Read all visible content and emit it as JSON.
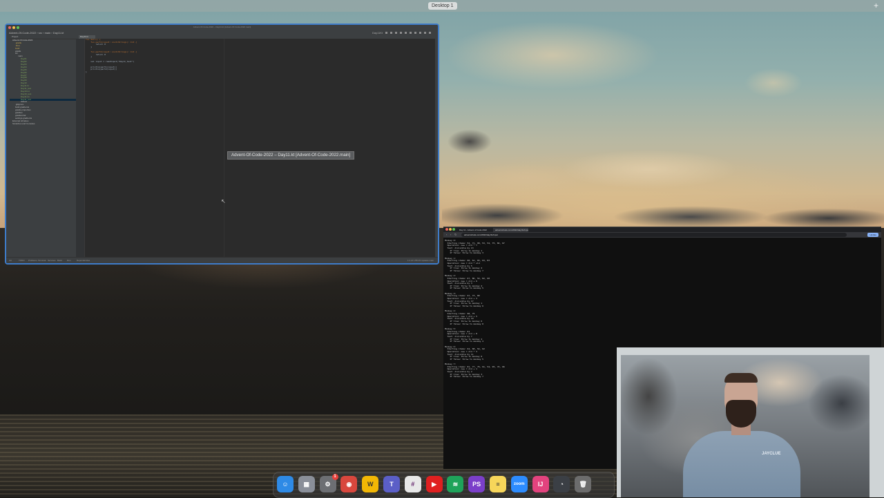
{
  "desktop": {
    "space_label": "Desktop 1",
    "add_space": "+"
  },
  "ide": {
    "title": "Advent-Of-Code-2022 – Day11.kt [Advent-Of-Code-2022.main]",
    "breadcrumb": "Advent-Of-Code-2022 › src › main › Day11.kt",
    "run_config": "Day11Kt",
    "active_tab": "Day11.kt",
    "project_panel_title": "Project",
    "tooltip": "Advent-Of-Code-2022 – Day11.kt [Advent-Of-Code-2022.main]",
    "tree": [
      {
        "label": "Advent-Of-Code-2022",
        "indent": 1,
        "color": "#cfcfcf"
      },
      {
        "label": ".gradle",
        "indent": 2,
        "color": "#c9a94e"
      },
      {
        "label": ".idea",
        "indent": 2,
        "color": "#c9a94e"
      },
      {
        "label": "build",
        "indent": 2,
        "color": "#c9a94e"
      },
      {
        "label": "gradle",
        "indent": 2,
        "color": "#bdbdbd"
      },
      {
        "label": "src",
        "indent": 2,
        "color": "#bdbdbd"
      },
      {
        "label": "main",
        "indent": 3,
        "color": "#bdbdbd"
      },
      {
        "label": "Day01",
        "indent": 4,
        "color": "#7fa35c"
      },
      {
        "label": "Day02",
        "indent": 4,
        "color": "#7fa35c"
      },
      {
        "label": "Day03",
        "indent": 4,
        "color": "#7fa35c"
      },
      {
        "label": "Day04",
        "indent": 4,
        "color": "#7fa35c"
      },
      {
        "label": "Day05",
        "indent": 4,
        "color": "#7fa35c"
      },
      {
        "label": "Day06",
        "indent": 4,
        "color": "#7fa35c"
      },
      {
        "label": "Day07",
        "indent": 4,
        "color": "#7fa35c"
      },
      {
        "label": "Day08",
        "indent": 4,
        "color": "#7fa35c"
      },
      {
        "label": "Day09",
        "indent": 4,
        "color": "#7fa35c"
      },
      {
        "label": "Day10",
        "indent": 4,
        "color": "#7fa35c"
      },
      {
        "label": "Day11.kt",
        "indent": 4,
        "color": "#7fa35c"
      },
      {
        "label": "Day11_test",
        "indent": 4,
        "color": "#7fa35c"
      },
      {
        "label": "Day10.txt",
        "indent": 4,
        "color": "#7fa35c"
      },
      {
        "label": "Day10_test",
        "indent": 4,
        "color": "#7fa35c"
      },
      {
        "label": "Day11.txt",
        "indent": 4,
        "color": "#7fa35c"
      },
      {
        "label": "Day11_test",
        "indent": 4,
        "color": "#7fa35c",
        "selected": true
      },
      {
        "label": "Utils.kt",
        "indent": 4,
        "color": "#bdbdbd"
      },
      {
        "label": ".gitignore",
        "indent": 2,
        "color": "#bdbdbd"
      },
      {
        "label": "build.gradle.kts",
        "indent": 2,
        "color": "#bdbdbd"
      },
      {
        "label": "gradle.properties",
        "indent": 2,
        "color": "#bdbdbd"
      },
      {
        "label": "gradlew",
        "indent": 2,
        "color": "#bdbdbd"
      },
      {
        "label": "gradlew.bat",
        "indent": 2,
        "color": "#bdbdbd"
      },
      {
        "label": "settings.gradle.kts",
        "indent": 2,
        "color": "#bdbdbd"
      },
      {
        "label": "External Libraries",
        "indent": 1,
        "color": "#bdbdbd"
      },
      {
        "label": "Scratches and Consoles",
        "indent": 1,
        "color": "#bdbdbd"
      }
    ],
    "code": [
      {
        "text": "fun main() {",
        "color": "#cc7832"
      },
      {
        "text": "    fun part1(input: List<String>): Int {",
        "color": "#cc7832"
      },
      {
        "text": "        return 0",
        "color": "#a9b7c6"
      },
      {
        "text": "    }",
        "color": "#a9b7c6"
      },
      {
        "text": "",
        "color": "#a9b7c6"
      },
      {
        "text": "    fun part2(input: List<String>): Int {",
        "color": "#cc7832"
      },
      {
        "text": "        return 0",
        "color": "#a9b7c6"
      },
      {
        "text": "    }",
        "color": "#a9b7c6"
      },
      {
        "text": "",
        "color": "#a9b7c6"
      },
      {
        "text": "    val input = readInput(\"Day11_test\")",
        "color": "#a9b7c6"
      },
      {
        "text": "",
        "color": "#a9b7c6"
      },
      {
        "text": "    println(part1(input))",
        "color": "#a9b7c6"
      },
      {
        "text": "    println(part2(input))",
        "color": "#a9b7c6"
      },
      {
        "text": "}",
        "color": "#a9b7c6"
      }
    ],
    "status_left": [
      "Git",
      "TODO",
      "Problems",
      "Terminal",
      "Services",
      "Build",
      "Run",
      "Dependencies"
    ],
    "status_right": "1:1  LF  UTF-8  4 spaces  main"
  },
  "browser": {
    "tabs": [
      "Day 11 - Advent of Code 2022",
      "adventofcode.com/2022/day/11/input"
    ],
    "url": "adventofcode.com/2022/day/11/input",
    "button": "Update",
    "lines": [
      "Monkey 0:",
      "  Starting items: 54, 71, 98, 53, 54, 75, 84, 67",
      "  Operation: new = old * 7",
      "  Test: divisible by 13",
      "    If true: throw to monkey 1",
      "    If false: throw to monkey 3",
      "",
      "Monkey 1:",
      "  Starting items: 60, 61, 65, 63, 83",
      "  Operation: new = old * old",
      "  Test: divisible by 5",
      "    If true: throw to monkey 2",
      "    If false: throw to monkey 7",
      "",
      "Monkey 2:",
      "  Starting items: 67, 86, 54, 82, 60",
      "  Operation: new = old + 6",
      "  Test: divisible by 3",
      "    If true: throw to monkey 4",
      "    If false: throw to monkey 5",
      "",
      "Monkey 3:",
      "  Starting items: 97, 73, 80",
      "  Operation: new = old + 3",
      "  Test: divisible by 17",
      "    If true: throw to monkey 1",
      "    If false: throw to monkey 6",
      "",
      "Monkey 4:",
      "  Starting items: 98, 75",
      "  Operation: new = old + 5",
      "  Test: divisible by 19",
      "    If true: throw to monkey 6",
      "    If false: throw to monkey 0",
      "",
      "Monkey 5:",
      "  Starting items: 61",
      "  Operation: new = old + 8",
      "  Test: divisible by 7",
      "    If true: throw to monkey 2",
      "    If false: throw to monkey 4",
      "",
      "Monkey 6:",
      "  Starting items: 64, 68, 54, 62",
      "  Operation: new = old * 3",
      "  Test: divisible by 11",
      "    If true: throw to monkey 0",
      "    If false: throw to monkey 5",
      "",
      "Monkey 7:",
      "  Starting items: 81, 77, 76, 91, 54, 95, 74, 66",
      "  Operation: new = old + 1",
      "  Test: divisible by 2",
      "    If true: throw to monkey 3",
      "    If false: throw to monkey 7"
    ]
  },
  "webcam": {
    "shirt_logo": "JAYCLUE"
  },
  "dock": [
    {
      "name": "finder",
      "letter": "☺",
      "color": "#2e8ae6"
    },
    {
      "name": "launchpad",
      "letter": "▦",
      "color": "#8a8f99"
    },
    {
      "name": "system-preferences",
      "letter": "⚙",
      "color": "#6d6f73",
      "badge": "1"
    },
    {
      "name": "chrome",
      "letter": "◉",
      "color": "#d9473d"
    },
    {
      "name": "notes-w",
      "letter": "W",
      "color": "#f2b705"
    },
    {
      "name": "teams",
      "letter": "T",
      "color": "#5b5fc7"
    },
    {
      "name": "slack",
      "letter": "#",
      "color": "#e8e8e8"
    },
    {
      "name": "video-player",
      "letter": "▶",
      "color": "#e02020"
    },
    {
      "name": "audio-app",
      "letter": "≋",
      "color": "#1fa35a"
    },
    {
      "name": "phpstorm",
      "letter": "PS",
      "color": "#7b3fc9"
    },
    {
      "name": "notes",
      "letter": "≡",
      "color": "#f7d65a"
    },
    {
      "name": "zoom",
      "letter": "zoom",
      "color": "#2d8cff"
    },
    {
      "name": "intellij",
      "letter": "IJ",
      "color": "#e3437e"
    },
    {
      "name": "activity-monitor",
      "letter": "◔",
      "color": "#3b3f45"
    },
    {
      "name": "trash",
      "letter": "🗑",
      "color": "#6c6c6c"
    }
  ]
}
